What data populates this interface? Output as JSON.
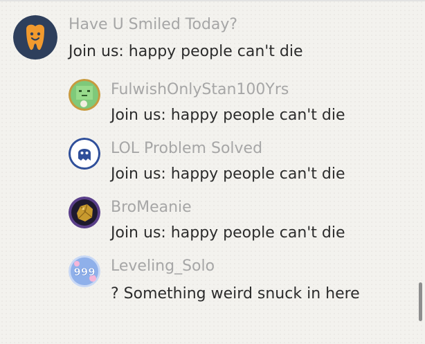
{
  "comment": {
    "username": "Have U Smiled Today?",
    "text": "Join us: happy people can't die",
    "avatar_icon": "smiling-tooth-icon"
  },
  "replies": [
    {
      "username": "FulwishOnlyStan100Yrs",
      "text": "Join us: happy people can't die",
      "avatar_icon": "green-block-character-icon"
    },
    {
      "username": "LOL Problem Solved",
      "text": "Join us: happy people can't die",
      "avatar_icon": "white-ghost-icon"
    },
    {
      "username": "BroMeanie",
      "text": "Join us: happy people can't die",
      "avatar_icon": "gold-nugget-icon"
    },
    {
      "username": "Leveling_Solo",
      "text": "? Something weird snuck in here",
      "avatar_icon": "999-badge-icon",
      "avatar_badge_text": "999"
    }
  ],
  "colors": {
    "background": "#f3f2ee",
    "username": "#a6a6a6",
    "message": "#2b2b2b",
    "scrollbar": "#8e8e8e"
  }
}
